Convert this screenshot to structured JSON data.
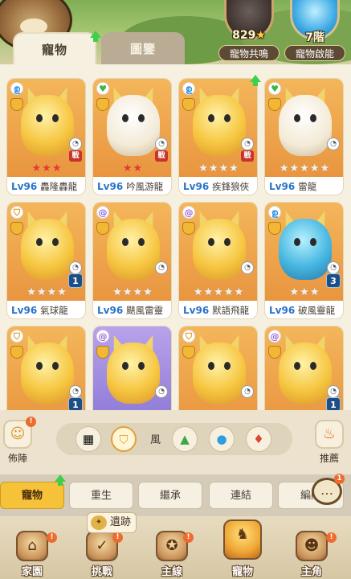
{
  "tabs": [
    {
      "label": "寵物",
      "active": true
    },
    {
      "label": "圖鑒",
      "active": false
    }
  ],
  "resonance": {
    "value": "829",
    "star": "★",
    "label": "寵物共鳴"
  },
  "potential": {
    "value": "7階",
    "label": "寵物啟能"
  },
  "pets": [
    {
      "level": "Lv96",
      "name": "轟隆轟龍",
      "element_icon": "wind-icon",
      "stars_on": 3,
      "stars_total": 3,
      "badge": "戰"
    },
    {
      "level": "Lv96",
      "name": "吟風游龍",
      "element_icon": "heal-icon",
      "stars_on": 2,
      "stars_total": 2,
      "badge": "戰"
    },
    {
      "level": "Lv96",
      "name": "疾鋒狼俠",
      "element_icon": "wind-icon",
      "stars_on": 0,
      "stars_total": 4,
      "badge": "戰"
    },
    {
      "level": "Lv96",
      "name": "雷龍",
      "element_icon": "heal-icon",
      "stars_on": 0,
      "stars_total": 5,
      "badge": ""
    },
    {
      "level": "Lv96",
      "name": "氣球龍",
      "element_icon": "shield-icon",
      "stars_on": 0,
      "stars_total": 4,
      "team": "1"
    },
    {
      "level": "Lv96",
      "name": "颶風雷靈",
      "element_icon": "swirl-icon",
      "stars_on": 0,
      "stars_total": 4,
      "team": ""
    },
    {
      "level": "Lv96",
      "name": "默語飛龍",
      "element_icon": "swirl-icon",
      "stars_on": 0,
      "stars_total": 5,
      "team": ""
    },
    {
      "level": "Lv96",
      "name": "破風靈龍",
      "element_icon": "wind-icon",
      "stars_on": 0,
      "stars_total": 3,
      "team": "3"
    },
    {
      "level": "",
      "name": "",
      "element_icon": "shield-icon",
      "team": "1"
    },
    {
      "level": "",
      "name": "",
      "element_icon": "swirl-icon",
      "team": ""
    },
    {
      "level": "",
      "name": "",
      "element_icon": "shield-icon",
      "team": ""
    },
    {
      "level": "",
      "name": "",
      "element_icon": "swirl-icon",
      "team": "1"
    }
  ],
  "filter": {
    "formation_label": "佈陣",
    "recommend_label": "推薦",
    "wind_label": "風",
    "element_icons": [
      "grid-icon",
      "shield-icon",
      "mountain-icon",
      "water-icon",
      "fire-icon"
    ]
  },
  "subtabs": [
    {
      "label": "寵物",
      "active": true
    },
    {
      "label": "重生",
      "active": false
    },
    {
      "label": "繼承",
      "active": false
    },
    {
      "label": "連結",
      "active": false
    },
    {
      "label": "編隊",
      "active": false
    }
  ],
  "chat_badge": "1",
  "tooltip": {
    "label": "遺跡"
  },
  "nav": [
    {
      "label": "家園",
      "icon": "home-icon",
      "active": false
    },
    {
      "label": "挑戰",
      "icon": "challenge-icon",
      "active": false
    },
    {
      "label": "主線",
      "icon": "main-line-icon",
      "active": false
    },
    {
      "label": "寵物",
      "icon": "pet-icon",
      "active": true
    },
    {
      "label": "主角",
      "icon": "hero-icon",
      "active": false
    }
  ]
}
